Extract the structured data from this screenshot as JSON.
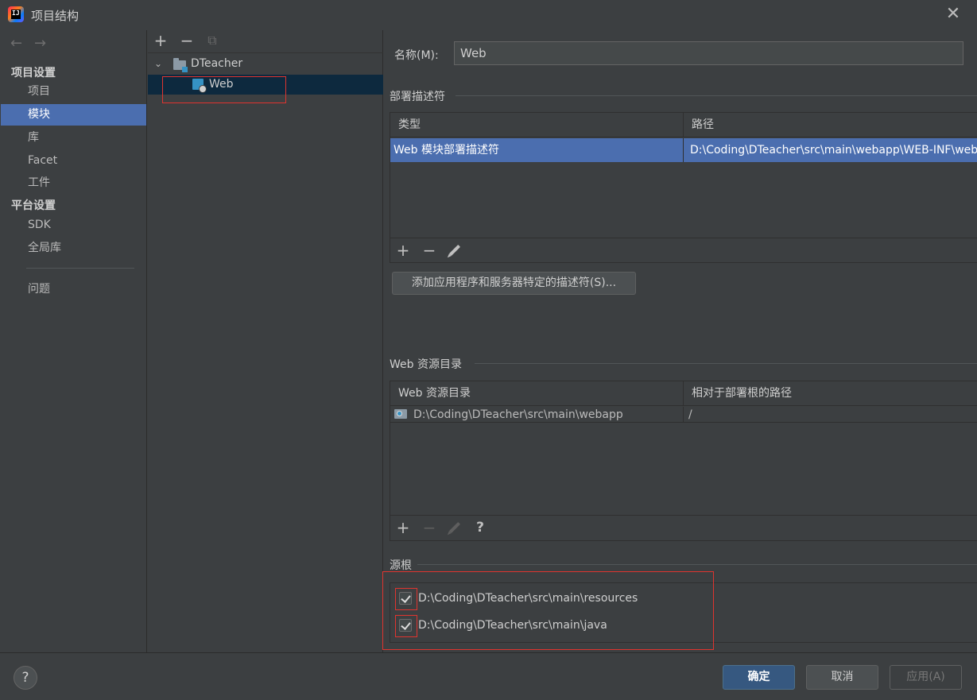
{
  "window": {
    "title": "项目结构",
    "close_glyph": "✕"
  },
  "nav": {
    "back_glyph": "←",
    "forward_glyph": "→"
  },
  "sidebar": {
    "project_settings_header": "项目设置",
    "platform_settings_header": "平台设置",
    "items": [
      {
        "label": "项目"
      },
      {
        "label": "模块",
        "selected": true
      },
      {
        "label": "库"
      },
      {
        "label": "Facet"
      },
      {
        "label": "工件"
      },
      {
        "label": "SDK"
      },
      {
        "label": "全局库"
      },
      {
        "label": "问题"
      }
    ]
  },
  "tree": {
    "toolbar": {
      "add": "+",
      "remove": "−",
      "copy": "⧉"
    },
    "root": {
      "label": "DTeacher",
      "chevron": "⌄"
    },
    "child": {
      "label": "Web",
      "selected": true
    }
  },
  "module": {
    "name_label": "名称(M):",
    "name_value": "Web"
  },
  "deployment": {
    "title": "部署描述符",
    "columns": [
      "类型",
      "路径"
    ],
    "rows": [
      {
        "type": "Web 模块部署描述符",
        "path": "D:\\Coding\\DTeacher\\src\\main\\webapp\\WEB-INF\\web.xml",
        "selected": true
      }
    ],
    "toolbar": {
      "add": "+",
      "remove": "−"
    },
    "add_button_label": "添加应用程序和服务器特定的描述符(S)..."
  },
  "web_resources": {
    "title": "Web 资源目录",
    "columns": [
      "Web 资源目录",
      "相对于部署根的路径"
    ],
    "rows": [
      {
        "dir": "D:\\Coding\\DTeacher\\src\\main\\webapp",
        "relative": "/"
      }
    ],
    "toolbar": {
      "add": "+",
      "remove": "−",
      "help": "?"
    }
  },
  "source_roots": {
    "title": "源根",
    "items": [
      {
        "path": "D:\\Coding\\DTeacher\\src\\main\\resources",
        "checked": true
      },
      {
        "path": "D:\\Coding\\DTeacher\\src\\main\\java",
        "checked": true
      }
    ]
  },
  "footer": {
    "help": "?",
    "ok": "确定",
    "cancel": "取消",
    "apply": "应用(A)"
  },
  "colors": {
    "selection": "#4b6eaf",
    "tree_selection": "#0d293e",
    "annotation_red": "#e0342f",
    "ok_button": "#365880"
  }
}
